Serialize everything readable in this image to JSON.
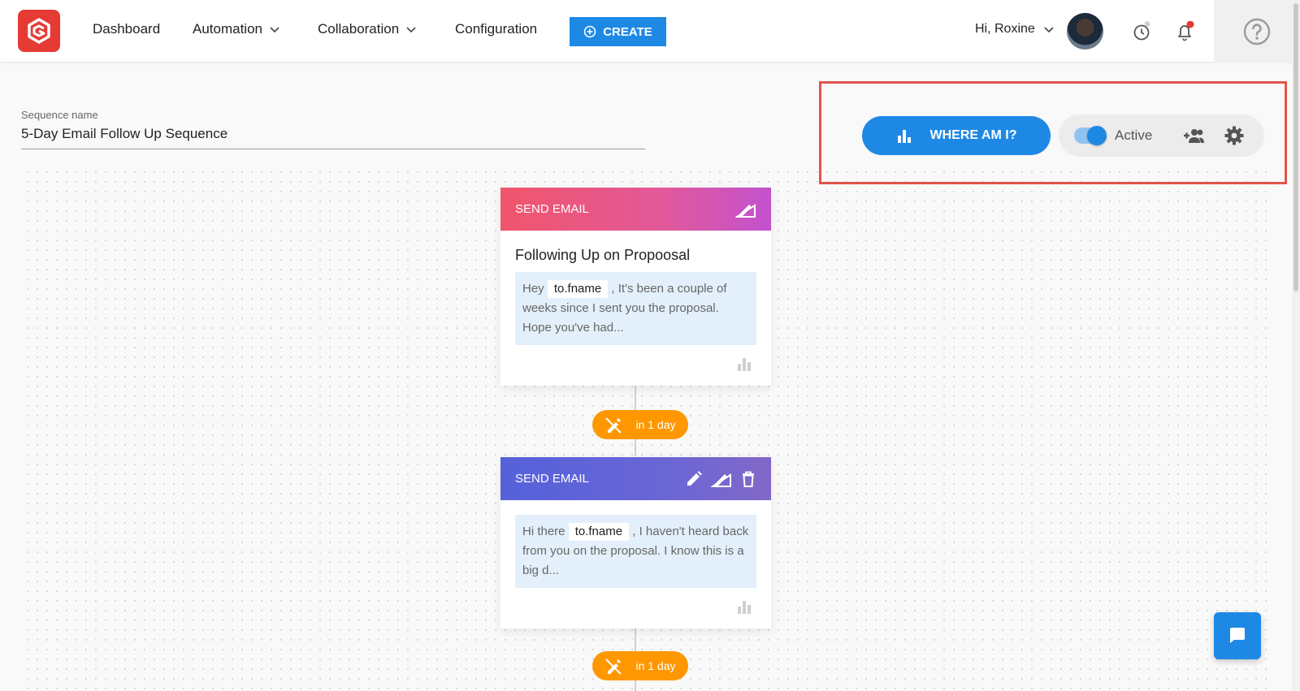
{
  "nav": {
    "items": [
      {
        "label": "Dashboard"
      },
      {
        "label": "Automation"
      },
      {
        "label": "Collaboration"
      },
      {
        "label": "Configuration"
      }
    ],
    "create_label": "CREATE",
    "greeting": "Hi, Roxine"
  },
  "sequence": {
    "label": "Sequence name",
    "name": "5-Day Email Follow Up Sequence"
  },
  "controls": {
    "where_label": "WHERE AM I?",
    "active_label": "Active",
    "active": true
  },
  "steps": [
    {
      "header": "SEND EMAIL",
      "title": "Following Up on Propoosal",
      "snippet_prefix": "Hey",
      "token": "to.fname",
      "snippet_rest": ",   It's been a couple of weeks since I sent you the proposal. Hope you've had..."
    },
    {
      "delay": "in 1 day"
    },
    {
      "header": "SEND EMAIL",
      "snippet_prefix": "Hi there",
      "token": "to.fname",
      "snippet_rest": ",   I haven't heard back from you on the proposal. I know this is a big d..."
    },
    {
      "delay": "in 1 day"
    }
  ],
  "colors": {
    "primary": "#1e88e5",
    "brand_red": "#e63a35",
    "delay_orange": "#ff9800",
    "highlight_red": "#e0554b"
  },
  "icons": [
    "logo-icon",
    "chevron-down-icon",
    "plus-circle-icon",
    "history-icon",
    "bell-icon",
    "help-icon",
    "bar-chart-icon",
    "add-group-icon",
    "gear-icon",
    "edit-icon",
    "pencil-ruler-icon",
    "trash-icon",
    "no-edit-icon",
    "chat-icon"
  ]
}
